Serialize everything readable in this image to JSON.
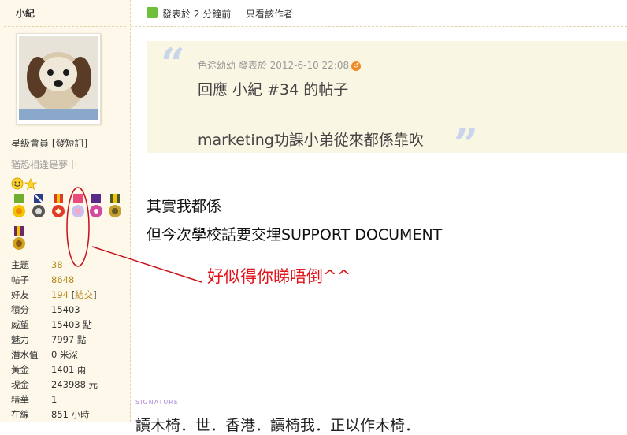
{
  "sidebar": {
    "username": "小紀",
    "rank": "星級會員",
    "send_message_label": "發短訊",
    "motto": "猶恐相逢是夢中",
    "stats": [
      {
        "label": "主題",
        "value": "38",
        "link": true
      },
      {
        "label": "帖子",
        "value": "8648",
        "link": true
      },
      {
        "label": "好友",
        "value": "194",
        "extra": "結交",
        "link": true
      },
      {
        "label": "積分",
        "value": "15403",
        "link": false
      },
      {
        "label": "威望",
        "value": "15403 點",
        "link": false
      },
      {
        "label": "魅力",
        "value": "7997 點",
        "link": false
      },
      {
        "label": "潛水值",
        "value": "0 米深",
        "link": false
      },
      {
        "label": "黃金",
        "value": "1401 兩",
        "link": false
      },
      {
        "label": "現金",
        "value": "243988 元",
        "link": false
      },
      {
        "label": "精華",
        "value": "1",
        "link": false
      },
      {
        "label": "在線",
        "value": "851 小時",
        "link": false
      }
    ]
  },
  "post": {
    "posted_time": "發表於 2 分鐘前",
    "author_only_label": "只看該作者",
    "quote": {
      "meta": "色途幼幼 發表於 2012-6-10 22:08",
      "title": "回應 小紀 #34 的帖子",
      "body": "marketing功課小弟從來都係靠吹"
    },
    "lines": [
      "其實我都係",
      "但今次學校話要交埋SUPPORT DOCUMENT"
    ],
    "annotation": "好似得你睇唔倒^^",
    "signature_label": "SIGNATURE",
    "signature_text": "讀木椅．世．香港．讀椅我．正以作木椅．"
  },
  "colors": {
    "sidebar_bg": "#fdf8ea",
    "quote_bg": "#faf6e4",
    "annotation_red": "#e0141a",
    "link_gold": "#b58a1c"
  },
  "icons": {
    "post_icon": "user-post-icon",
    "refresh_icon": "back-arrow-icon",
    "smiley": "smiley-icon",
    "star": "star-icon"
  }
}
